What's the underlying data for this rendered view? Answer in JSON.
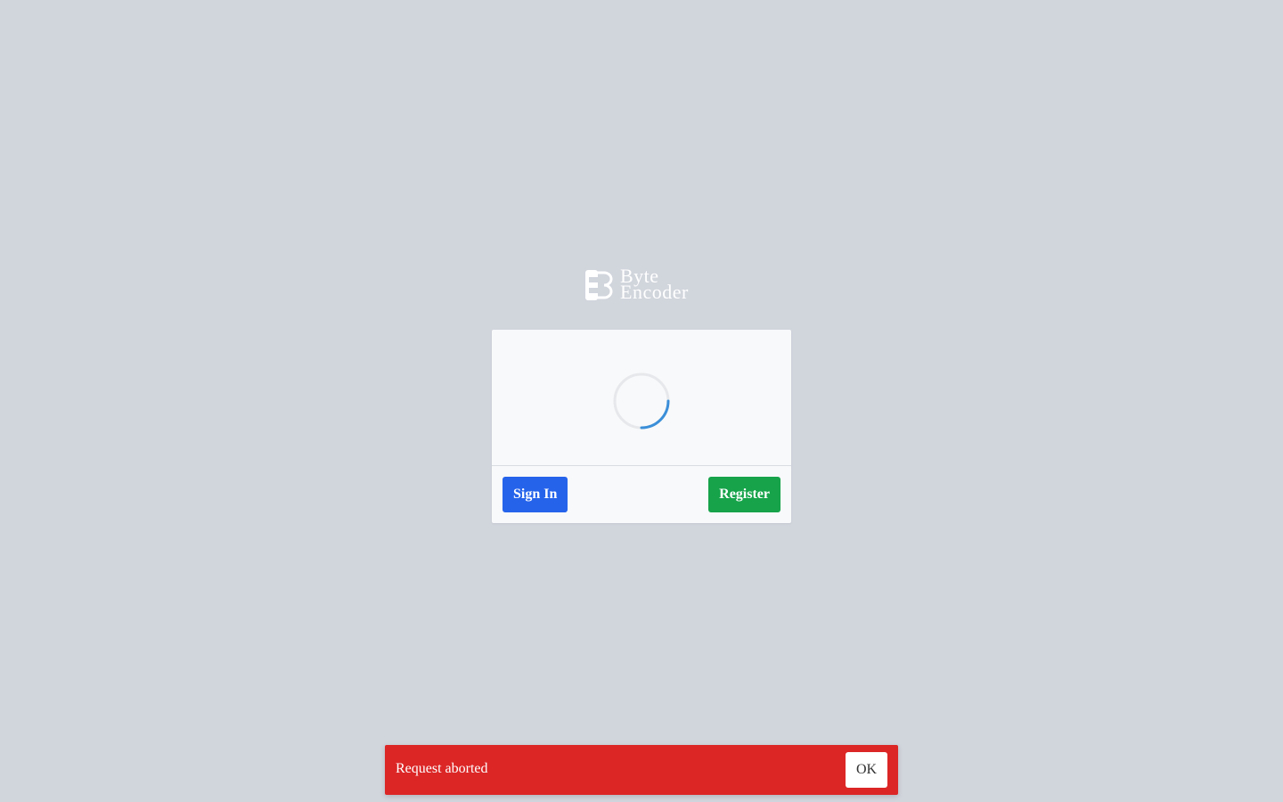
{
  "logo": {
    "line1": "Byte",
    "line2": "Encoder",
    "icon": "byteencoder-logo-mark"
  },
  "card": {
    "status": "loading",
    "spinner_icon": "loading-spinner-icon",
    "sign_in_label": "Sign In",
    "register_label": "Register"
  },
  "toast": {
    "message": "Request aborted",
    "ok_label": "OK"
  },
  "colors": {
    "background": "#d1d5dc",
    "card": "#f8f9fa",
    "sign_in": "#2563eb",
    "register": "#16a34a",
    "toast": "#dc2626",
    "spinner_accent": "#3b8fd9"
  }
}
